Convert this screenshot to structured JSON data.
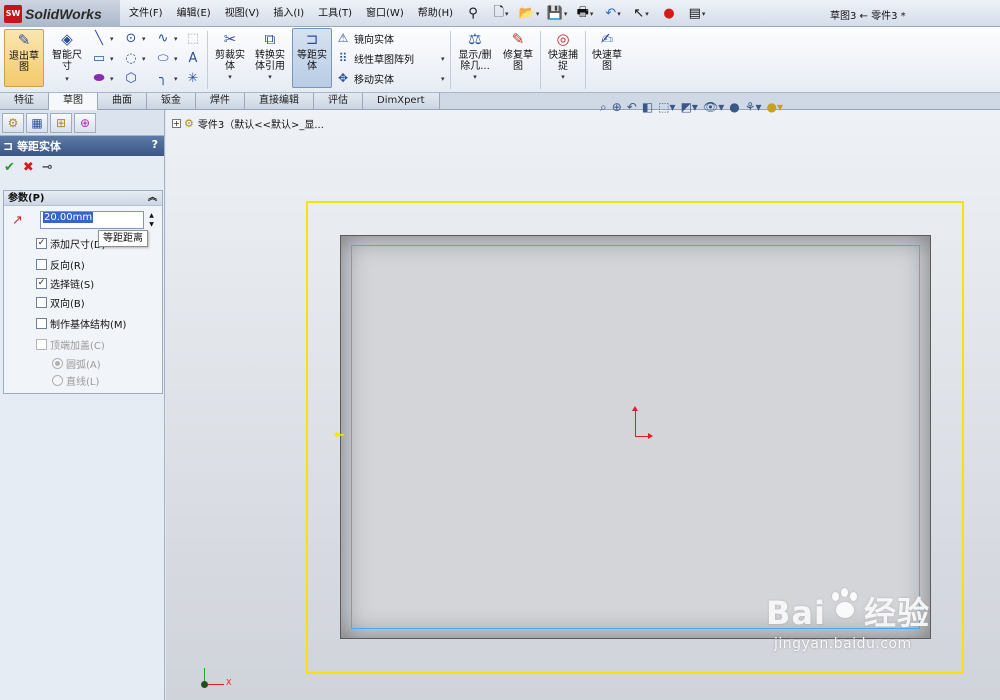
{
  "app": {
    "logo_badge": "SW",
    "name": "SolidWorks"
  },
  "menu": [
    "文件(F)",
    "编辑(E)",
    "视图(V)",
    "插入(I)",
    "工具(T)",
    "窗口(W)",
    "帮助(H)"
  ],
  "document_title": "草图3 ← 零件3 *",
  "ribbon": {
    "exit_sketch": "退出草图",
    "smart_dimension": "智能尺寸",
    "trim": "剪裁实体",
    "convert": "转换实体引用",
    "offset": "等距实体",
    "mirror": "镜向实体",
    "linear_pattern": "线性草图阵列",
    "move": "移动实体",
    "display_delete": "显示/删除几...",
    "repair": "修复草图",
    "quick_snap": "快速捕捉",
    "rapid_sketch": "快速草图"
  },
  "tabs": [
    "特征",
    "草图",
    "曲面",
    "钣金",
    "焊件",
    "直接编辑",
    "评估",
    "DimXpert"
  ],
  "active_tab": "草图",
  "property_manager": {
    "title": "等距实体",
    "help": "?",
    "group_title": "参数(P)",
    "distance_value": "20.00mm",
    "tooltip": "等距距离",
    "options": [
      {
        "label": "添加尺寸(D)",
        "checked": true,
        "enabled": true
      },
      {
        "label": "反向(R)",
        "checked": false,
        "enabled": true
      },
      {
        "label": "选择链(S)",
        "checked": true,
        "enabled": true
      },
      {
        "label": "双向(B)",
        "checked": false,
        "enabled": true
      },
      {
        "label": "制作基体结构(M)",
        "checked": false,
        "enabled": true
      },
      {
        "label": "顶端加盖(C)",
        "checked": false,
        "enabled": false
      }
    ],
    "cap_radios": [
      {
        "label": "圆弧(A)",
        "selected": true
      },
      {
        "label": "直线(L)",
        "selected": false
      }
    ]
  },
  "feature_tree": {
    "label": "零件3（默认<<默认>_显..."
  },
  "triad": {
    "x_label": "X"
  },
  "watermark": {
    "main_left": "Bai",
    "main_right": "经验",
    "sub": "jingyan.baidu.com"
  },
  "colors": {
    "offset_outline": "#f5e400",
    "sketch_line": "#4aa6ff",
    "origin": "#e02020",
    "header_blue": "#3a5787"
  },
  "icons": {
    "exit_sketch": "exit-sketch-icon",
    "smart_dimension": "smart-dimension-icon",
    "offset": "offset-entities-icon",
    "accept": "check-icon",
    "cancel": "close-icon",
    "pin": "pin-icon"
  }
}
